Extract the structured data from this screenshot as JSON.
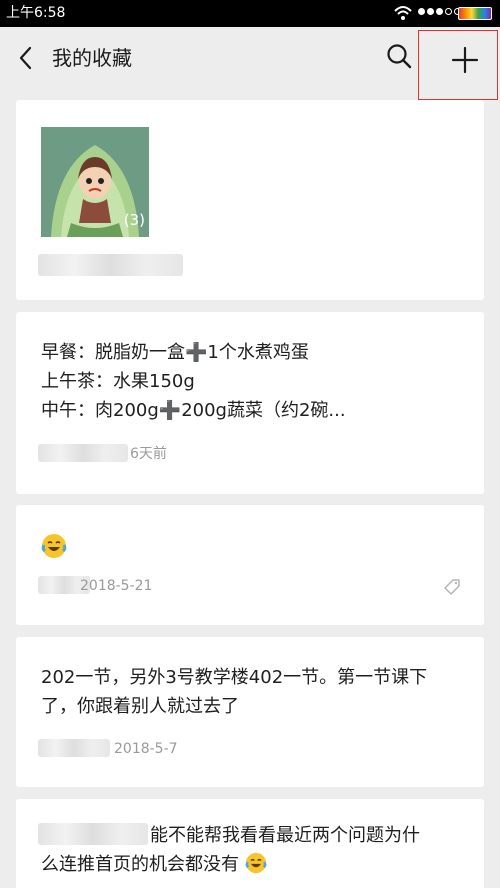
{
  "status_bar": {
    "time": "上午6:58"
  },
  "header": {
    "title": "我的收藏",
    "icons": [
      "back-icon",
      "search-icon",
      "plus-icon"
    ]
  },
  "items": [
    {
      "type": "image",
      "thumbnail_count": "(3)"
    },
    {
      "type": "note",
      "lines": [
        "早餐：脱脂奶一盒➕1个水煮鸡蛋",
        "上午茶：水果150g",
        "中午：肉200g➕200g蔬菜（约2碗..."
      ],
      "time": "6天前"
    },
    {
      "type": "emoji",
      "emoji": "laughing-crying-emoji",
      "date": "2018-5-21",
      "tag_icon": "tag-icon"
    },
    {
      "type": "text",
      "lines": [
        "202一节，另外3号教学楼402一节。第一节课下",
        "了，你跟着别人就过去了"
      ],
      "date": "2018-5-7"
    },
    {
      "type": "text",
      "lines": [
        "能不能帮我看看最近两个问题为什",
        "么连推首页的机会都没有"
      ]
    }
  ],
  "colors": {
    "background": "#ededed",
    "card": "#ffffff",
    "meta_text": "#9a9a9a",
    "highlight_box": "#e0302f"
  }
}
